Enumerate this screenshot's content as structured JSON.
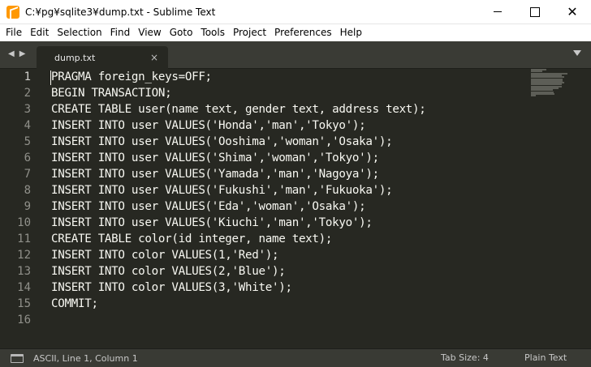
{
  "window": {
    "title": "C:¥pg¥sqlite3¥dump.txt - Sublime Text",
    "close_glyph": "✕"
  },
  "menu": [
    "File",
    "Edit",
    "Selection",
    "Find",
    "View",
    "Goto",
    "Tools",
    "Project",
    "Preferences",
    "Help"
  ],
  "tabs": {
    "active": "dump.txt",
    "close_glyph": "×",
    "nav_left": "◀",
    "nav_right": "▶"
  },
  "editor": {
    "lines": [
      "PRAGMA foreign_keys=OFF;",
      "BEGIN TRANSACTION;",
      "CREATE TABLE user(name text, gender text, address text);",
      "INSERT INTO user VALUES('Honda','man','Tokyo');",
      "INSERT INTO user VALUES('Ooshima','woman','Osaka');",
      "INSERT INTO user VALUES('Shima','woman','Tokyo');",
      "INSERT INTO user VALUES('Yamada','man','Nagoya');",
      "INSERT INTO user VALUES('Fukushi','man','Fukuoka');",
      "INSERT INTO user VALUES('Eda','woman','Osaka');",
      "INSERT INTO user VALUES('Kiuchi','man','Tokyo');",
      "CREATE TABLE color(id integer, name text);",
      "INSERT INTO color VALUES(1,'Red');",
      "INSERT INTO color VALUES(2,'Blue');",
      "INSERT INTO color VALUES(3,'White');",
      "COMMIT;",
      ""
    ],
    "current_line": 1
  },
  "status": {
    "position": "ASCII, Line 1, Column 1",
    "tab_size": "Tab Size: 4",
    "syntax": "Plain Text"
  }
}
